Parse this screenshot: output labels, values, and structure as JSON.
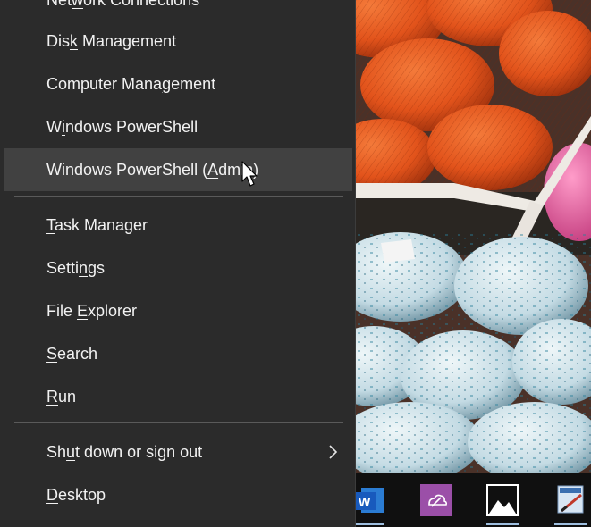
{
  "menu": {
    "items": [
      {
        "key": "network",
        "pre": "Net",
        "acc": "w",
        "post": "ork Connections"
      },
      {
        "key": "disk",
        "pre": "Dis",
        "acc": "k",
        "post": " Management"
      },
      {
        "key": "computer",
        "pre": "Computer Mana",
        "acc": "g",
        "post": "ement"
      },
      {
        "key": "powershell",
        "pre": "W",
        "acc": "i",
        "post": "ndows PowerShell"
      },
      {
        "key": "powershell-admin",
        "pre": "Windows PowerShell (",
        "acc": "A",
        "post": "dmin)"
      },
      {
        "key": "task-manager",
        "pre": "",
        "acc": "T",
        "post": "ask Manager"
      },
      {
        "key": "settings",
        "pre": "Setti",
        "acc": "n",
        "post": "gs"
      },
      {
        "key": "file-explorer",
        "pre": "File ",
        "acc": "E",
        "post": "xplorer"
      },
      {
        "key": "search",
        "pre": "",
        "acc": "S",
        "post": "earch"
      },
      {
        "key": "run",
        "pre": "",
        "acc": "R",
        "post": "un"
      },
      {
        "key": "shutdown",
        "pre": "Sh",
        "acc": "u",
        "post": "t down or sign out"
      },
      {
        "key": "desktop",
        "pre": "",
        "acc": "D",
        "post": "esktop"
      }
    ],
    "hovered": "powershell-admin"
  },
  "taskbar": {
    "icons": [
      "word-icon",
      "onenote-icon",
      "photos-icon",
      "paint-icon"
    ],
    "word_glyph": "W"
  },
  "colors": {
    "menu_bg": "#2b2b2b",
    "hover_bg": "#414141",
    "text": "#f2f2f2",
    "divider": "#5a5a5a",
    "yarn_orange": "#e8561c",
    "yarn_blue": "#cfe2ea",
    "yarn_pink": "#f06aa8"
  }
}
